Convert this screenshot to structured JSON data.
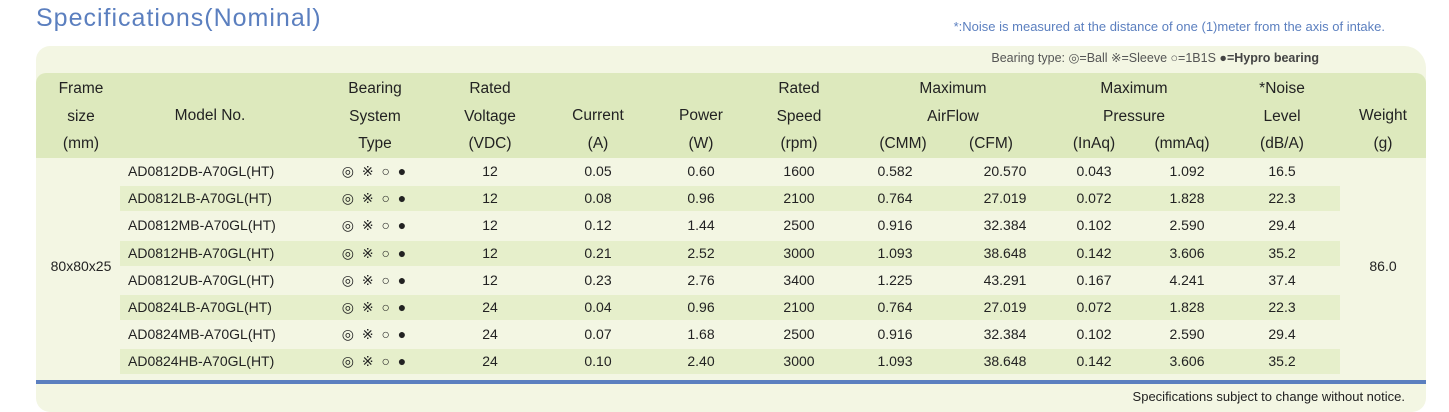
{
  "title": "Specifications(Nominal)",
  "noise_note": "*:Noise is measured at the distance of one (1)meter from the axis of intake.",
  "bearing_legend": {
    "prefix": "Bearing type: ",
    "text": "◎=Ball ※=Sleeve ○=1B1S ",
    "bold": "●=Hypro bearing"
  },
  "headers": {
    "frame": [
      "Frame",
      "size",
      "(mm)"
    ],
    "model": "Model No.",
    "bearing": [
      "Bearing",
      "System",
      "Type"
    ],
    "voltage": [
      "Rated",
      "Voltage",
      "(VDC)"
    ],
    "current": [
      "Current",
      "(A)"
    ],
    "power": [
      "Power",
      "(W)"
    ],
    "speed": [
      "Rated",
      "Speed",
      "(rpm)"
    ],
    "airflow": [
      "Maximum",
      "AirFlow"
    ],
    "airflow_units": [
      "(CMM)",
      "(CFM)"
    ],
    "pressure": [
      "Maximum",
      "Pressure"
    ],
    "pressure_units": [
      "(InAq)",
      "(mmAq)"
    ],
    "noise": [
      "*Noise",
      "Level",
      "(dB/A)"
    ],
    "weight": [
      "Weight",
      "(g)"
    ]
  },
  "frame_size": "80x80x25",
  "weight": "86.0",
  "bearing_symbols": "◎ ※ ○ ●",
  "rows": [
    {
      "model": "AD0812DB-A70GL(HT)",
      "voltage": "12",
      "current": "0.05",
      "power": "0.60",
      "speed": "1600",
      "cmm": "0.582",
      "cfm": "20.570",
      "inaq": "0.043",
      "mmaq": "1.092",
      "noise": "16.5"
    },
    {
      "model": "AD0812LB-A70GL(HT)",
      "voltage": "12",
      "current": "0.08",
      "power": "0.96",
      "speed": "2100",
      "cmm": "0.764",
      "cfm": "27.019",
      "inaq": "0.072",
      "mmaq": "1.828",
      "noise": "22.3"
    },
    {
      "model": "AD0812MB-A70GL(HT)",
      "voltage": "12",
      "current": "0.12",
      "power": "1.44",
      "speed": "2500",
      "cmm": "0.916",
      "cfm": "32.384",
      "inaq": "0.102",
      "mmaq": "2.590",
      "noise": "29.4"
    },
    {
      "model": "AD0812HB-A70GL(HT)",
      "voltage": "12",
      "current": "0.21",
      "power": "2.52",
      "speed": "3000",
      "cmm": "1.093",
      "cfm": "38.648",
      "inaq": "0.142",
      "mmaq": "3.606",
      "noise": "35.2"
    },
    {
      "model": "AD0812UB-A70GL(HT)",
      "voltage": "12",
      "current": "0.23",
      "power": "2.76",
      "speed": "3400",
      "cmm": "1.225",
      "cfm": "43.291",
      "inaq": "0.167",
      "mmaq": "4.241",
      "noise": "37.4"
    },
    {
      "model": "AD0824LB-A70GL(HT)",
      "voltage": "24",
      "current": "0.04",
      "power": "0.96",
      "speed": "2100",
      "cmm": "0.764",
      "cfm": "27.019",
      "inaq": "0.072",
      "mmaq": "1.828",
      "noise": "22.3"
    },
    {
      "model": "AD0824MB-A70GL(HT)",
      "voltage": "24",
      "current": "0.07",
      "power": "1.68",
      "speed": "2500",
      "cmm": "0.916",
      "cfm": "32.384",
      "inaq": "0.102",
      "mmaq": "2.590",
      "noise": "29.4"
    },
    {
      "model": "AD0824HB-A70GL(HT)",
      "voltage": "24",
      "current": "0.10",
      "power": "2.40",
      "speed": "3000",
      "cmm": "1.093",
      "cfm": "38.648",
      "inaq": "0.142",
      "mmaq": "3.606",
      "noise": "35.2"
    }
  ],
  "footer": "Specifications subject to change without notice."
}
